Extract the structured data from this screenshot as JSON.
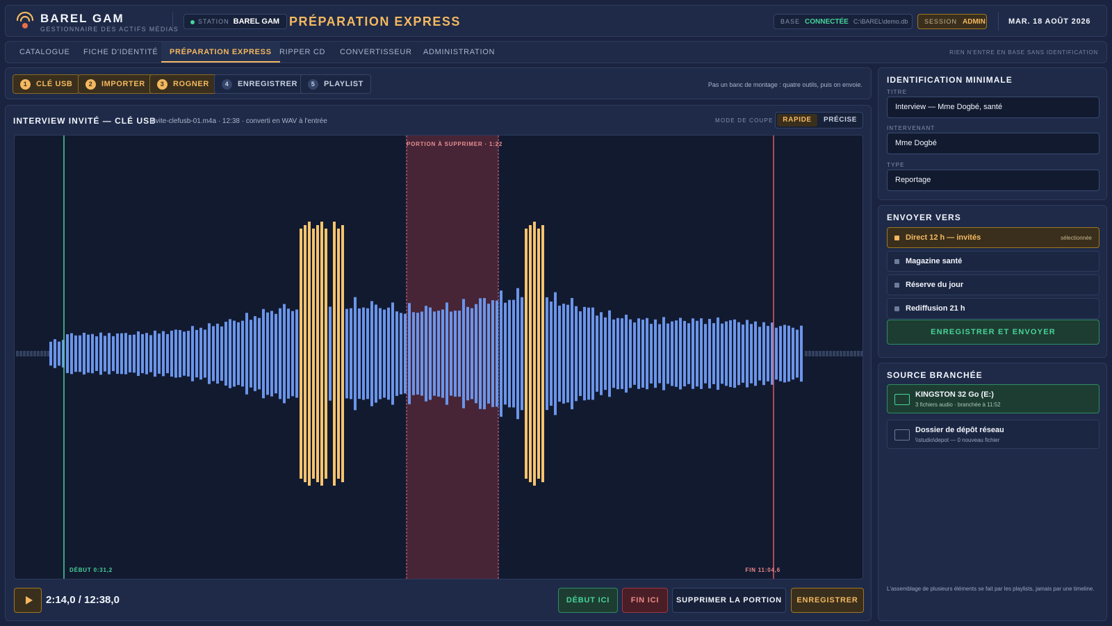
{
  "header": {
    "brand_name": "BAREL GAM",
    "brand_subtitle": "GESTIONNAIRE DES ACTIFS MÉDIAS",
    "station_label": "STATION",
    "station_value": "BAREL GAM",
    "page_title": "PRÉPARATION EXPRESS",
    "base_label": "BASE",
    "base_status": "CONNECTÉE",
    "base_path": "C:\\BAREL\\demo.db",
    "session_label": "SESSION",
    "session_value": "ADMIN",
    "date": "MAR. 18 AOÛT 2026"
  },
  "nav": {
    "tabs": [
      {
        "label": "CATALOGUE",
        "active": false
      },
      {
        "label": "FICHE D'IDENTITÉ",
        "active": false
      },
      {
        "label": "PRÉPARATION EXPRESS",
        "active": true
      },
      {
        "label": "RIPPER CD",
        "active": false
      },
      {
        "label": "CONVERTISSEUR",
        "active": false
      },
      {
        "label": "ADMINISTRATION",
        "active": false
      }
    ],
    "note": "RIEN N'ENTRE EN BASE SANS IDENTIFICATION"
  },
  "steps": {
    "items": [
      {
        "num": "1",
        "label": "CLÉ USB",
        "done": true
      },
      {
        "num": "2",
        "label": "IMPORTER",
        "done": true
      },
      {
        "num": "3",
        "label": "ROGNER",
        "done": true
      },
      {
        "num": "4",
        "label": "ENREGISTRER",
        "done": false
      },
      {
        "num": "5",
        "label": "PLAYLIST",
        "done": false
      }
    ],
    "note": "Pas un banc de montage : quatre outils, puis on envoie."
  },
  "editor": {
    "clip_title": "INTERVIEW INVITÉ — CLÉ USB",
    "clip_meta": "invite-clefusb-01.m4a · 12:38 · converti en WAV à l'entrée",
    "cut_mode_label": "MODE DE COUPE",
    "cut_mode_options": [
      "RAPIDE",
      "PRÉCISE"
    ],
    "cut_mode_selected": "RAPIDE",
    "cut_region_label": "PORTION À SUPPRIMER · 1:22",
    "start_marker_label": "DÉBUT 0:31,2",
    "end_marker_label": "FIN 11:04,6",
    "time_readout": "2:14,0 / 12:38,0",
    "buttons": {
      "start_here": "DÉBUT ICI",
      "end_here": "FIN ICI",
      "delete_portion": "SUPPRIMER LA PORTION",
      "save": "ENREGISTRER"
    },
    "colors": {
      "wave": "#6b95ea",
      "wave_highlight": "#f7c46c",
      "start_marker": "#46d49a",
      "end_marker": "#e05a63",
      "cut_region": "#5a2a3a"
    }
  },
  "identification": {
    "title": "IDENTIFICATION MINIMALE",
    "fields": [
      {
        "label": "TITRE",
        "value": "Interview — Mme Dogbé, santé"
      },
      {
        "label": "INTERVENANT",
        "value": "Mme Dogbé"
      },
      {
        "label": "TYPE",
        "value": "Reportage"
      }
    ]
  },
  "destination": {
    "title": "ENVOYER VERS",
    "items": [
      {
        "label": "Direct 12 h — invités",
        "selected": true,
        "tag": "sélectionnée"
      },
      {
        "label": "Magazine santé",
        "selected": false,
        "tag": ""
      },
      {
        "label": "Réserve du jour",
        "selected": false,
        "tag": ""
      },
      {
        "label": "Rediffusion 21 h",
        "selected": false,
        "tag": ""
      }
    ],
    "send_button": "ENREGISTRER ET ENVOYER"
  },
  "source": {
    "title": "SOURCE BRANCHÉE",
    "items": [
      {
        "name": "KINGSTON 32 Go (E:)",
        "detail": "3 fichiers audio · branchée à 11:52",
        "active": true
      },
      {
        "name": "Dossier de dépôt réseau",
        "detail": "\\\\studio\\depot — 0 nouveau fichier",
        "active": false
      }
    ],
    "footnote": "L'assemblage de plusieurs éléments se fait par les playlists, jamais par une timeline."
  }
}
